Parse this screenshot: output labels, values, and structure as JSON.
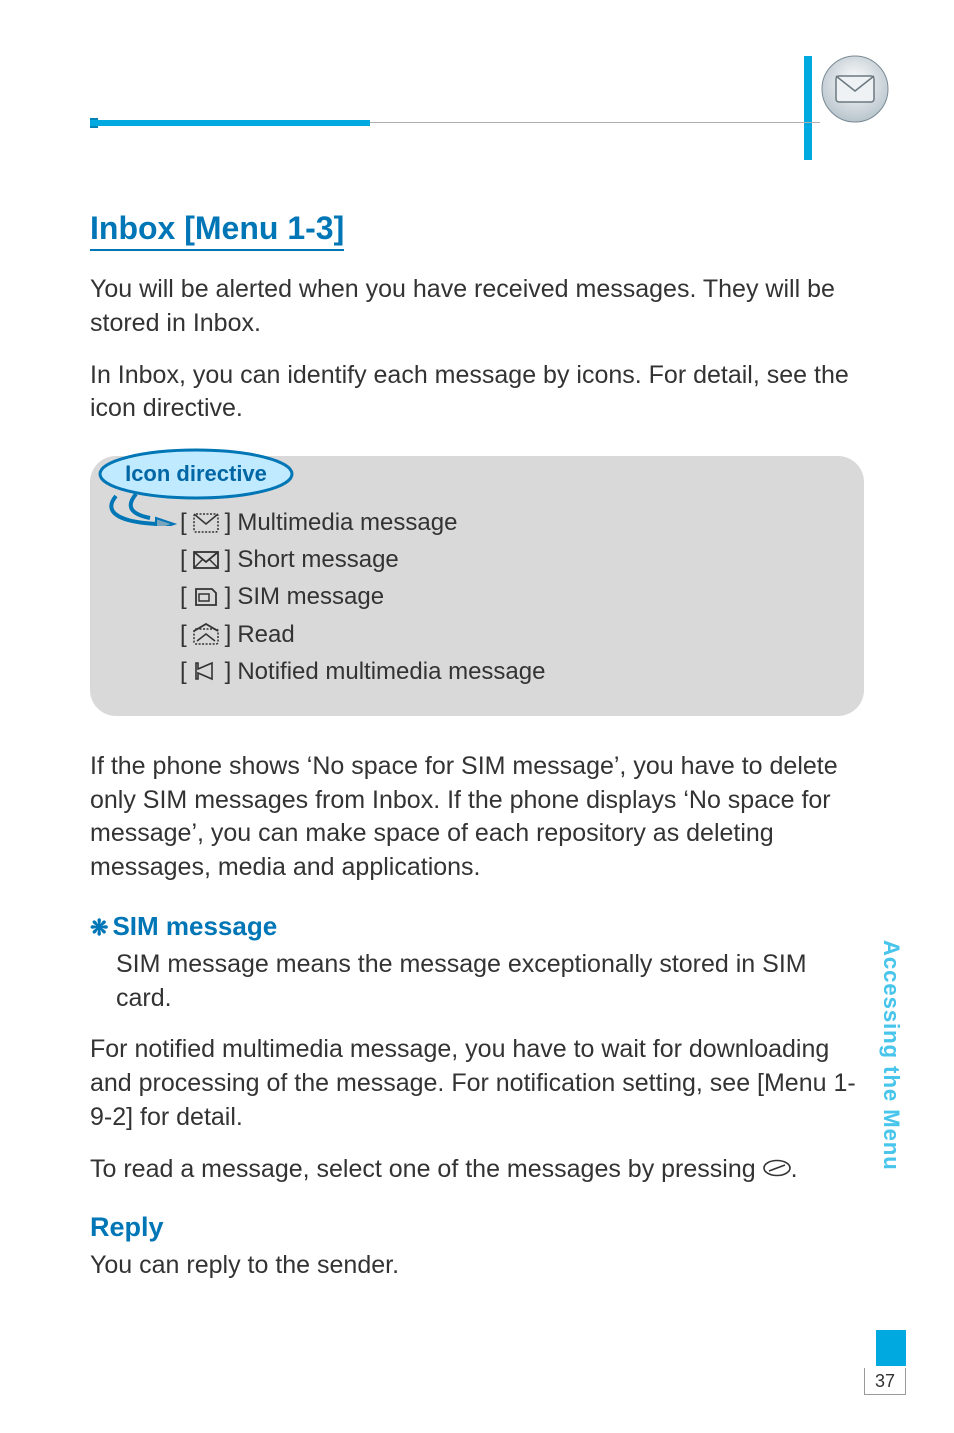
{
  "header": {
    "corner_icon": "envelope-3d-icon"
  },
  "section": {
    "title": "Inbox [Menu 1-3]",
    "intro1": "You will be alerted when you have received messages. They will be stored in Inbox.",
    "intro2": "In Inbox, you can identify each message by icons. For detail, see the icon directive."
  },
  "icon_directive": {
    "label": "Icon directive",
    "items": [
      {
        "icon": "mms-icon",
        "text": "Multimedia message"
      },
      {
        "icon": "sms-icon",
        "text": "Short message"
      },
      {
        "icon": "sim-msg-icon",
        "text": "SIM message"
      },
      {
        "icon": "read-icon",
        "text": "Read"
      },
      {
        "icon": "notified-mms-icon",
        "text": "Notified multimedia message"
      }
    ]
  },
  "after_box": "If the phone shows ‘No space for SIM message’, you have to delete only SIM messages from Inbox. If the phone displays ‘No space for message’, you can make space of each repository as deleting messages, media and applications.",
  "sim": {
    "heading": "SIM message",
    "body": "SIM message means the message exceptionally stored in SIM card."
  },
  "notified": "For notified multimedia message, you have to wait for downloading and processing of the message. For notification setting, see [Menu 1-9-2] for detail.",
  "read_line_prefix": "To read a message, select one of the messages by pressing ",
  "read_line_suffix": ".",
  "reply": {
    "heading": "Reply",
    "body": "You can reply to the sender."
  },
  "side_tab": "Accessing the Menu",
  "page_number": "37"
}
